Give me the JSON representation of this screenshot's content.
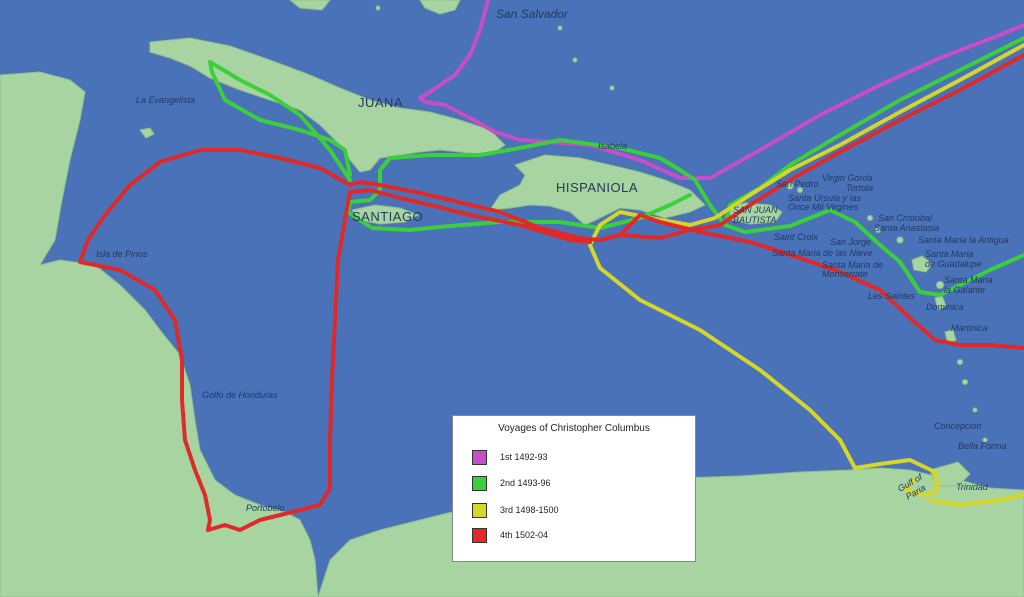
{
  "legend": {
    "title": "Voyages of Christopher Columbus",
    "items": [
      {
        "label": "1st 1492-93",
        "color": "#c84dc8"
      },
      {
        "label": "2nd 1493-96",
        "color": "#3ccf3c"
      },
      {
        "label": "3rd 1498-1500",
        "color": "#d6d62a"
      },
      {
        "label": "4th 1502-04",
        "color": "#e02a2a"
      }
    ]
  },
  "colors": {
    "sea": "#4a72b8",
    "land": "#a7d4a0"
  },
  "labels": {
    "san_salvador": "San Salvador",
    "juana": "JUANA",
    "la_evangelista": "La Evangelista",
    "isabela": "Isabela",
    "hispaniola": "HISPANIOLA",
    "santiago": "SANTIAGO",
    "san_juan_bautista_1": "SAN JUAN",
    "san_juan_bautista_2": "BAUTISTA",
    "isla_de_pinos": "Isla de Pinos",
    "golfo_de_honduras": "Golfo de Honduras",
    "portobelo": "Portobelo",
    "san_pedro": "San Pedro",
    "virgin_gorda": "Virgin Gorda",
    "tortola": "Tortola",
    "santa_ursula_1": "Santa Ursula y las",
    "santa_ursula_2": "Once Mil Virgines",
    "san_cristobal": "San Cristobal",
    "santa_anastasia": "Santa Anastasia",
    "saint_croix": "Saint Croix",
    "san_jorge": "San Jorge",
    "santa_maria_antigua": "Santa Maria la Antigua",
    "santa_maria_nieve": "Santa Maria de las Nieve",
    "santa_maria_guadalupe_1": "Santa Maria",
    "santa_maria_guadalupe_2": "de Guadalupe",
    "santa_maria_monserrate_1": "Santa Maria de",
    "santa_maria_monserrate_2": "Monserrate",
    "santa_maria_galante_1": "Santa Maria",
    "santa_maria_galante_2": "la Galante",
    "les_saintes": "Les Saintes",
    "dominica": "Dominica",
    "martinica": "Martinica",
    "concepcion": "Concepcion",
    "bella_forma": "Bella Forma",
    "gulf_of_paria_1": "Gulf of",
    "gulf_of_paria_2": "Paria",
    "trinidad": "Trinidad"
  }
}
